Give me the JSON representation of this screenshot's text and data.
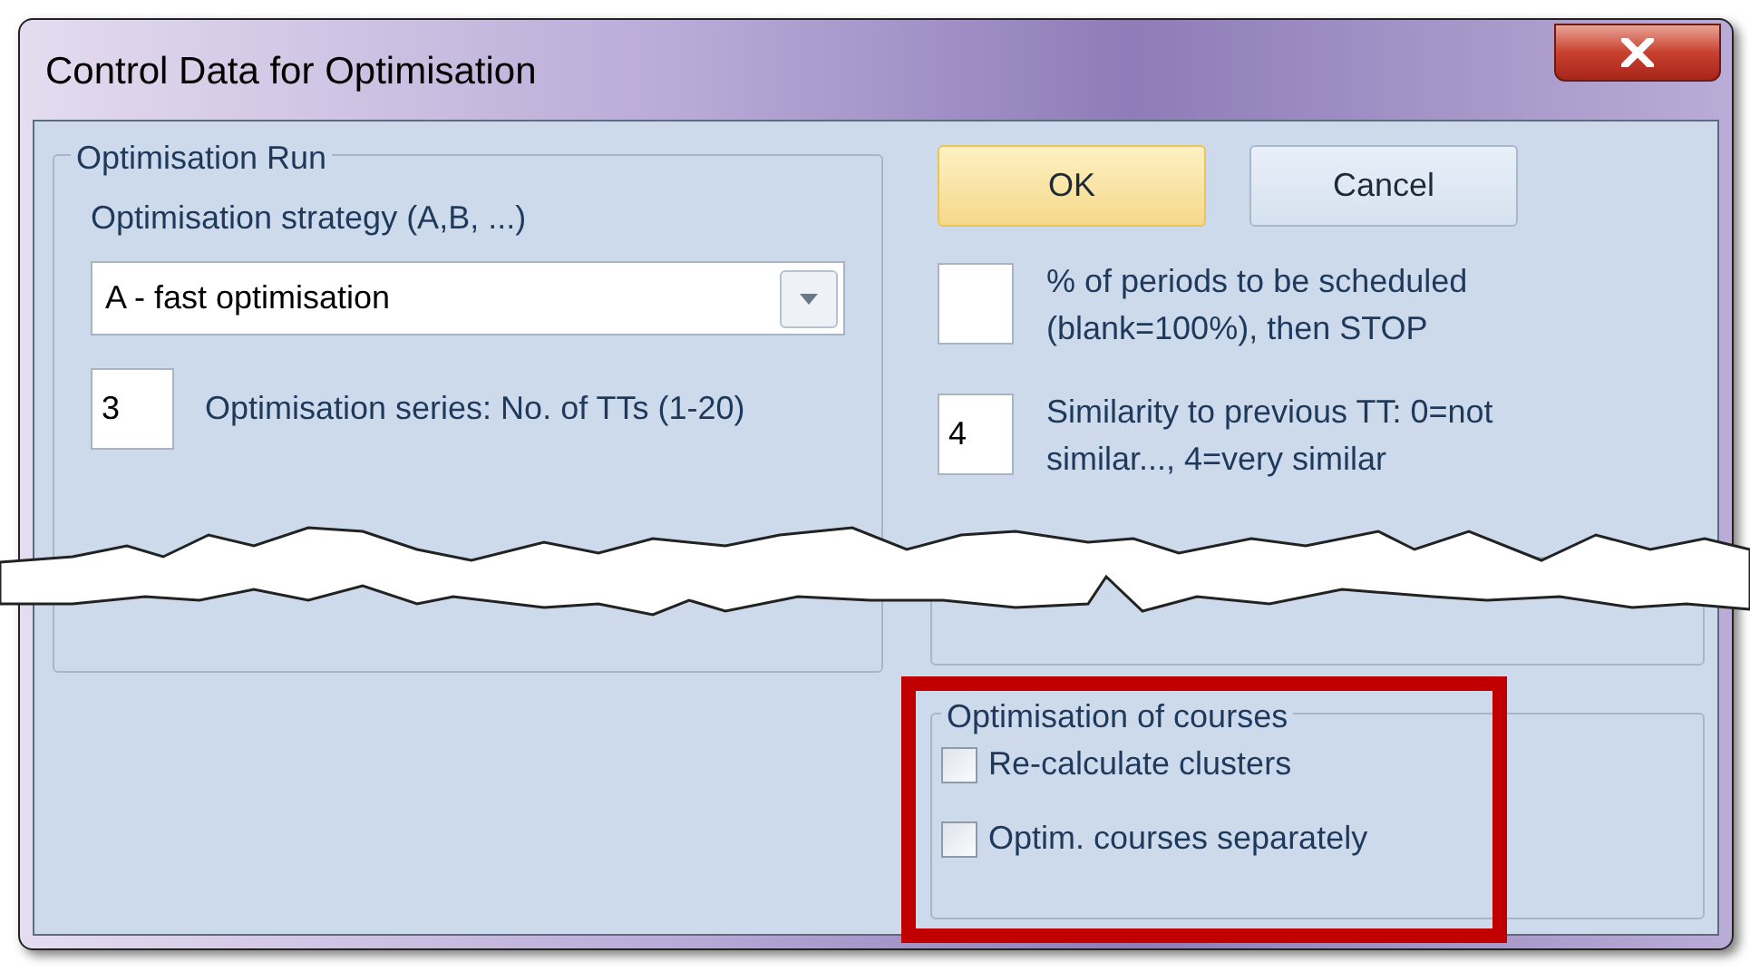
{
  "window": {
    "title": "Control Data for Optimisation"
  },
  "optimisation_run": {
    "title": "Optimisation Run",
    "strategy_label": "Optimisation strategy (A,B, ...)",
    "strategy_value": "A - fast optimisation",
    "series_value": "3",
    "series_label": "Optimisation series: No. of TTs (1-20)"
  },
  "buttons": [
    {
      "label": "OK",
      "default": true
    },
    {
      "label": "Cancel",
      "default": false
    }
  ],
  "right_fields": [
    {
      "label": "% of periods to be scheduled (blank=100%), then STOP"
    },
    {
      "value": "4",
      "label": "Similarity to previous TT: 0=not similar..., 4=very similar"
    }
  ],
  "courses": {
    "title": "Optimisation of courses",
    "options": [
      {
        "label": "Re-calculate clusters",
        "checked": false
      },
      {
        "label": "Optim. courses separately",
        "checked": false
      }
    ]
  }
}
